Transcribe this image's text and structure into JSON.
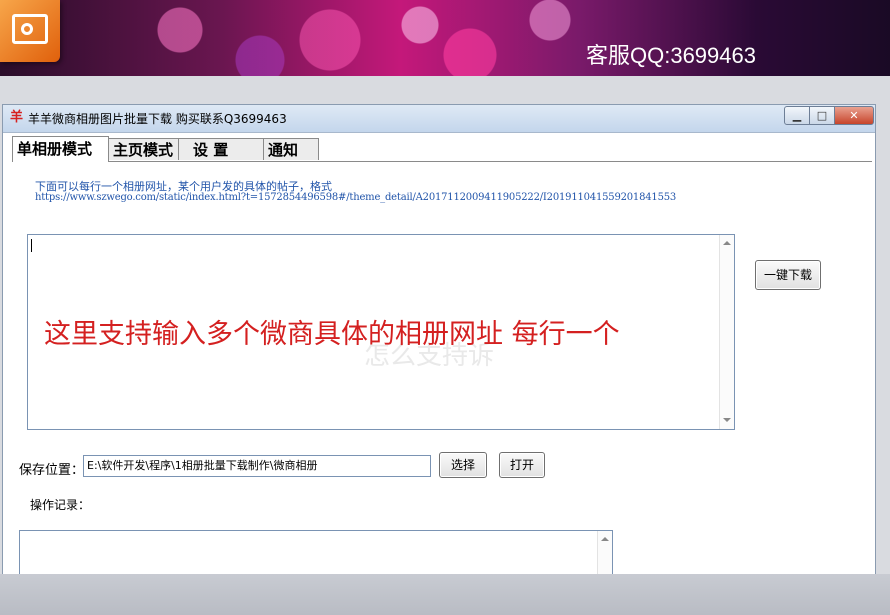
{
  "banner": {
    "support_text": "客服QQ:3699463"
  },
  "window": {
    "title": "羊羊微商相册图片批量下载 购买联系Q3699463",
    "app_icon_glyph": "羊",
    "controls": {
      "minimize": "▁",
      "maximize": "□",
      "close": "✕"
    }
  },
  "tabs": [
    {
      "label": "单相册模式",
      "active": true
    },
    {
      "label": "主页模式",
      "active": false
    },
    {
      "label": "设 置",
      "active": false
    },
    {
      "label": "通知",
      "active": false
    }
  ],
  "instructions": {
    "line1": "下面可以每行一个相册网址，某个用户发的具体的帖子，格式",
    "line2": "https://www.szwego.com/static/index.html?t=1572854496598#/theme_detail/A2017112009411905222/I2019110415592018415​53"
  },
  "url_input": {
    "value": "",
    "watermark": "怎么支持诉",
    "overlay_text": "这里支持输入多个微商具体的相册网址 每行一个"
  },
  "buttons": {
    "download": "一键下载",
    "select": "选择",
    "open": "打开"
  },
  "save": {
    "label": "保存位置：",
    "path": "E:\\软件开发\\程序\\1相册批量下载制作\\微商相册"
  },
  "log": {
    "label": "操作记录：",
    "content": ""
  },
  "colors": {
    "overlay_red": "#d42020",
    "info_blue": "#2255aa",
    "banner_pink": "#c4187a"
  }
}
